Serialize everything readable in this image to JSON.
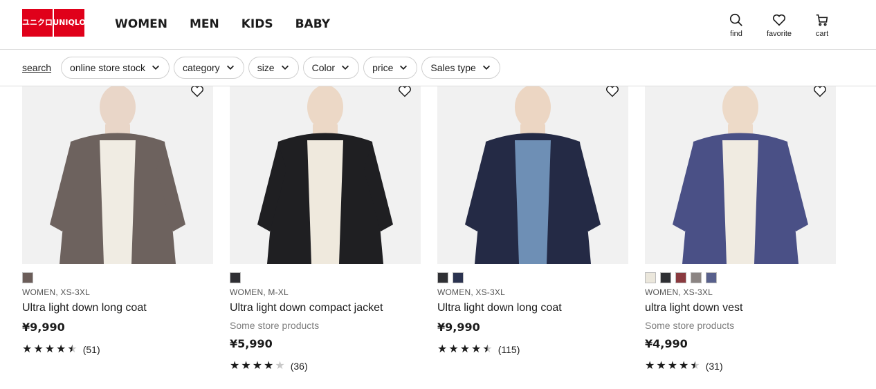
{
  "brand": {
    "logo_top": "ユニクロ",
    "logo_bottom": "UNIQLO",
    "color": "#e0001a"
  },
  "nav": {
    "items": [
      "WOMEN",
      "MEN",
      "KIDS",
      "BABY"
    ]
  },
  "utilities": [
    {
      "label": "find",
      "icon": "search-icon"
    },
    {
      "label": "favorite",
      "icon": "heart-icon"
    },
    {
      "label": "cart",
      "icon": "cart-icon"
    }
  ],
  "filters": {
    "search_label": "search",
    "chips": [
      "online store stock",
      "category",
      "size",
      "Color",
      "price",
      "Sales type"
    ]
  },
  "products": [
    {
      "meta": "WOMEN, XS-3XL",
      "name": "Ultra light down long coat",
      "availability": "",
      "price": "¥9,990",
      "rating": 4.5,
      "reviews": "(51)",
      "swatches": [
        "#6b5d59"
      ],
      "image_colors": {
        "bg": "#f1f1f1",
        "garment": "#6d625e",
        "inner": "#f0ece3",
        "skin": "#e9d6c8"
      }
    },
    {
      "meta": "WOMEN, M-XL",
      "name": "Ultra light down compact jacket",
      "availability": "Some store products",
      "price": "¥5,990",
      "rating": 4,
      "reviews": "(36)",
      "swatches": [
        "#2f2f33"
      ],
      "image_colors": {
        "bg": "#f1f1f1",
        "garment": "#1f1f22",
        "inner": "#efe9dd",
        "skin": "#ecd8c6"
      }
    },
    {
      "meta": "WOMEN, XS-3XL",
      "name": "Ultra light down long coat",
      "availability": "",
      "price": "¥9,990",
      "rating": 4.5,
      "reviews": "(115)",
      "swatches": [
        "#2f3034",
        "#2b3350"
      ],
      "image_colors": {
        "bg": "#f1f1f1",
        "garment": "#242a45",
        "inner": "#6e8fb5",
        "skin": "#ecd6c3"
      }
    },
    {
      "meta": "WOMEN, XS-3XL",
      "name": "ultra light down vest",
      "availability": "Some store products",
      "price": "¥4,990",
      "rating": 4.5,
      "reviews": "(31)",
      "swatches": [
        "#ebe7dc",
        "#2f3034",
        "#8a3a3f",
        "#8b8482",
        "#58608c"
      ],
      "image_colors": {
        "bg": "#f1f1f1",
        "garment": "#4a5086",
        "inner": "#f0ebe1",
        "skin": "#eddac8"
      }
    }
  ]
}
